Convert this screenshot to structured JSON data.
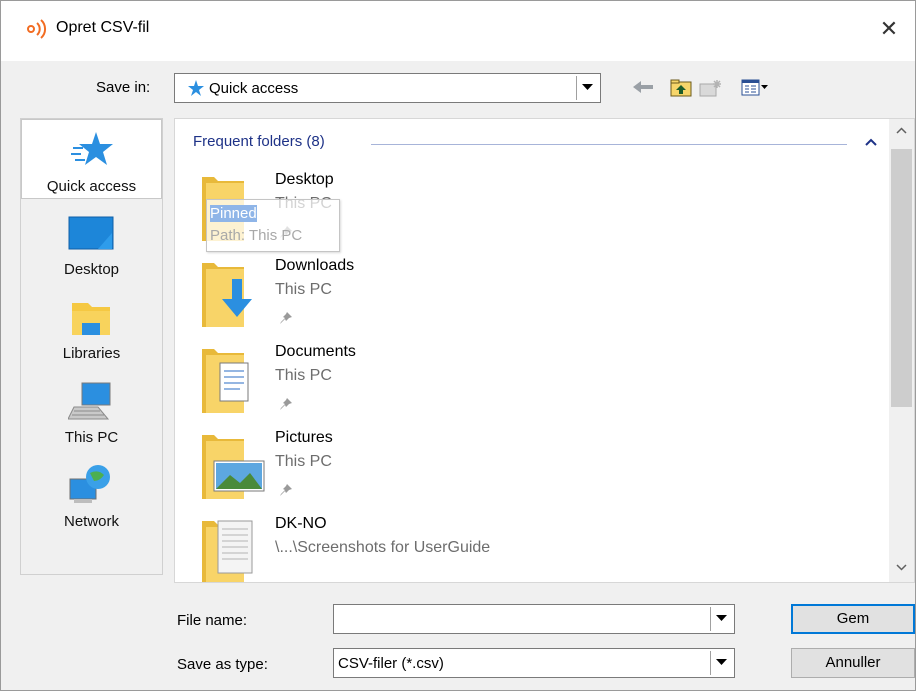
{
  "window": {
    "title": "Opret CSV-fil",
    "close_glyph": "✕"
  },
  "save_in": {
    "label": "Save in:",
    "value": "Quick access"
  },
  "places": [
    {
      "label": "Quick access",
      "icon": "quick-access-star-icon",
      "selected": true
    },
    {
      "label": "Desktop",
      "icon": "desktop-icon"
    },
    {
      "label": "Libraries",
      "icon": "libraries-icon"
    },
    {
      "label": "This PC",
      "icon": "this-pc-icon"
    },
    {
      "label": "Network",
      "icon": "network-icon"
    }
  ],
  "file_list": {
    "group_header": "Frequent folders (8)",
    "items": [
      {
        "name": "Desktop",
        "location": "This PC",
        "pinned": true,
        "icon": "desktop-folder-icon"
      },
      {
        "name": "Downloads",
        "location": "This PC",
        "pinned": true,
        "icon": "downloads-folder-icon"
      },
      {
        "name": "Documents",
        "location": "This PC",
        "pinned": true,
        "icon": "documents-folder-icon"
      },
      {
        "name": "Pictures",
        "location": "This PC",
        "pinned": true,
        "icon": "pictures-folder-icon"
      },
      {
        "name": "DK-NO",
        "location": "\\...\\Screenshots for UserGuide",
        "pinned": false,
        "icon": "dk-no-folder-icon"
      }
    ],
    "tooltip": {
      "line1_highlight": "Pinned",
      "line1_rest": "",
      "line2": "Path: This PC"
    }
  },
  "file_name": {
    "label": "File name:",
    "value": ""
  },
  "save_as_type": {
    "label": "Save as type:",
    "value": "CSV-filer (*.csv)"
  },
  "buttons": {
    "save": "Gem",
    "cancel": "Annuller"
  },
  "colors": {
    "accent": "#0078d7",
    "group_header": "#1e3287",
    "app_icon": "#f26c22"
  }
}
